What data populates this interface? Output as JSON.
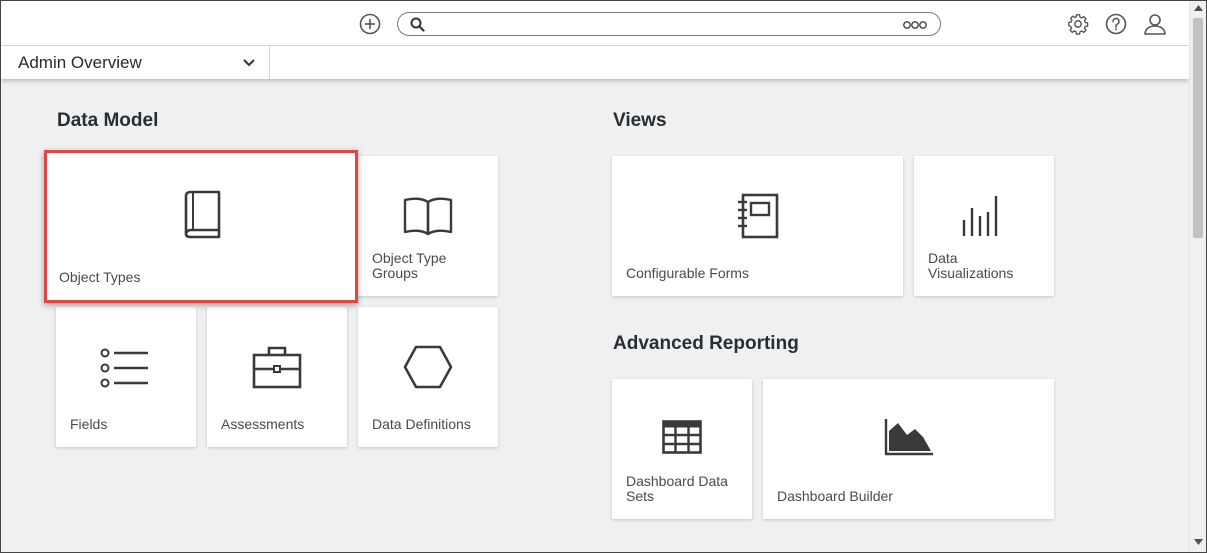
{
  "header": {
    "search": {
      "value": "",
      "placeholder": ""
    },
    "icons": {
      "add": "plus-circle-icon",
      "search": "search-icon",
      "more": "more-dots-icon",
      "settings": "gear-icon",
      "help": "help-icon",
      "user": "user-icon"
    }
  },
  "subheader": {
    "nav_label": "Admin Overview"
  },
  "sections": {
    "data_model": {
      "title": "Data Model",
      "cards": {
        "object_types": "Object Types",
        "object_type_groups": "Object Type Groups",
        "fields": "Fields",
        "assessments": "Assessments",
        "data_definitions": "Data Definitions"
      }
    },
    "views": {
      "title": "Views",
      "cards": {
        "configurable_forms": "Configurable Forms",
        "data_visualizations": "Data Visualizations"
      }
    },
    "advanced_reporting": {
      "title": "Advanced Reporting",
      "cards": {
        "dashboard_data_sets": "Dashboard Data Sets",
        "dashboard_builder": "Dashboard Builder"
      }
    }
  },
  "colors": {
    "highlight": "#e04545",
    "icon": "#3a3a3a",
    "background": "#f0f0f0"
  }
}
